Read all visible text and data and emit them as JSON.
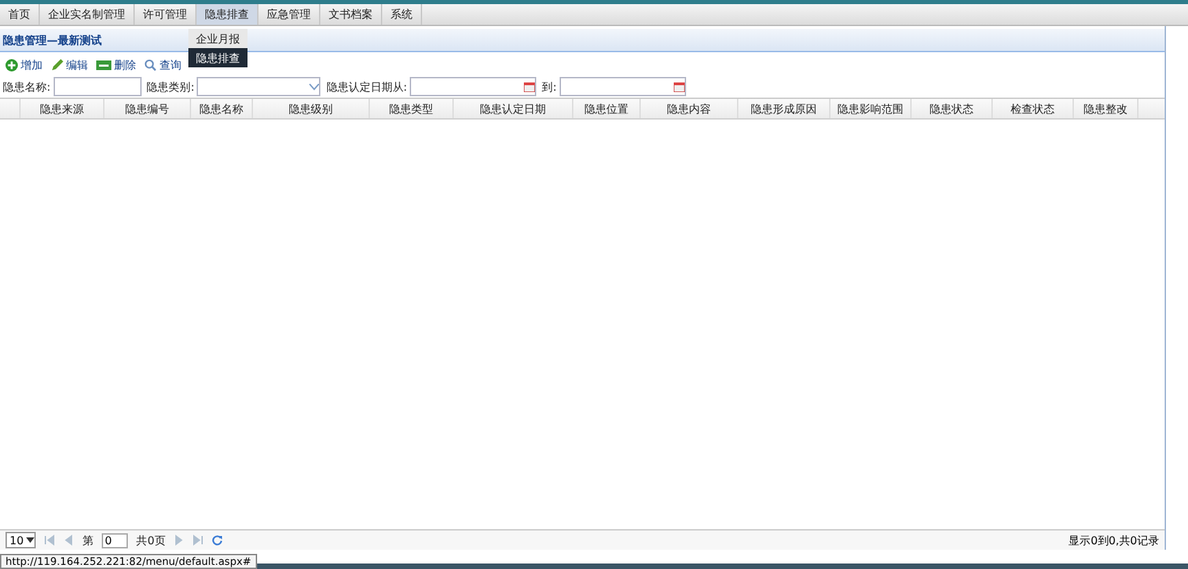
{
  "menu": [
    {
      "label": "首页",
      "selected": false
    },
    {
      "label": "企业实名制管理",
      "selected": false
    },
    {
      "label": "许可管理",
      "selected": false
    },
    {
      "label": "隐患排查",
      "selected": true
    },
    {
      "label": "应急管理",
      "selected": false
    },
    {
      "label": "文书档案",
      "selected": false
    },
    {
      "label": "系统",
      "selected": false
    }
  ],
  "dropdown": [
    {
      "label": "企业月报",
      "selected": false
    },
    {
      "label": "隐患排查",
      "selected": true
    }
  ],
  "panel_title": "隐患管理—最新测试",
  "toolbar": [
    {
      "label": "增加",
      "kind": "add"
    },
    {
      "label": "编辑",
      "kind": "edit"
    },
    {
      "label": "删除",
      "kind": "delete"
    },
    {
      "label": "查询",
      "kind": "search"
    }
  ],
  "filters": {
    "name_label": "隐患名称:",
    "type_label": "隐患类别:",
    "date_from_label": "隐患认定日期从:",
    "date_to_label": "到:"
  },
  "table": {
    "columns": [
      "隐患来源",
      "隐患编号",
      "隐患名称",
      "隐患级别",
      "隐患类型",
      "隐患认定日期",
      "隐患位置",
      "隐患内容",
      "隐患形成原因",
      "隐患影响范围",
      "隐患状态",
      "检查状态",
      "隐患整改"
    ]
  },
  "pager": {
    "page_size": "10",
    "page_prefix": "第",
    "page": "0",
    "page_total": "共0页",
    "summary": "显示0到0,共0记录"
  },
  "status_url": "http://119.164.252.221:82/menu/default.aspx#"
}
